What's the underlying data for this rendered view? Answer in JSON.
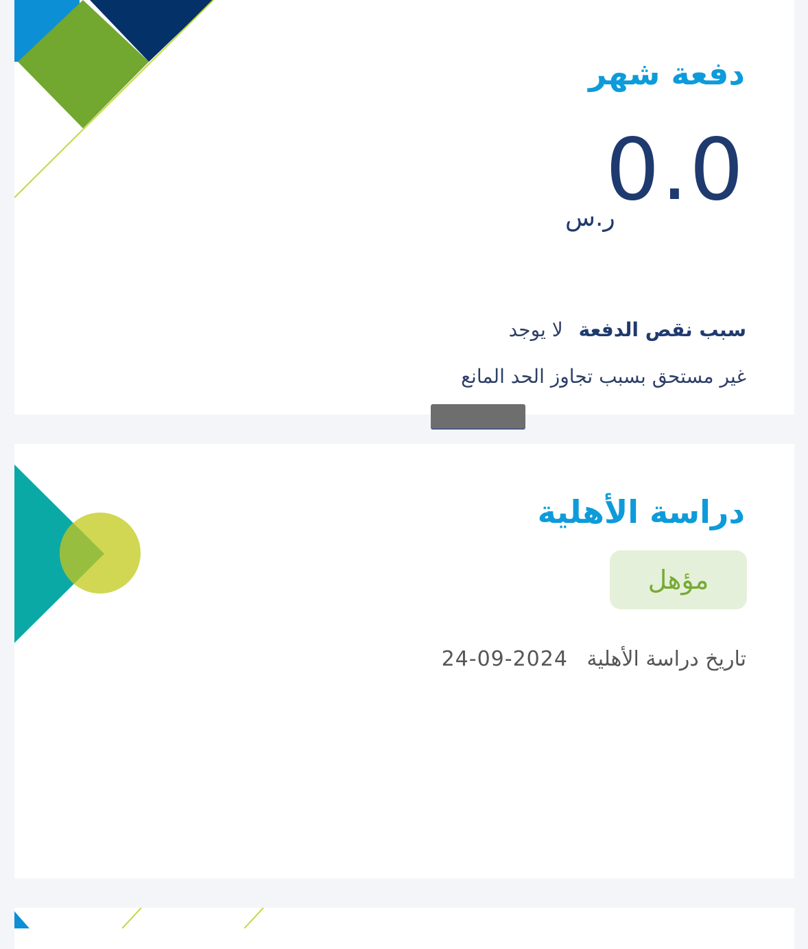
{
  "payment_card": {
    "title": "دفعة شهر",
    "amount": "0.0",
    "currency": "ر.س",
    "shortage_reason_label": "سبب نقص الدفعة",
    "shortage_reason_value": "لا يوجد",
    "eligibility_note": "غير مستحق بسبب تجاوز الحد المانع"
  },
  "eligibility_card": {
    "title": "دراسة الأهلية",
    "status": "مؤهل",
    "date_label": "تاريخ دراسة الأهلية",
    "date_value": "24-09-2024"
  },
  "colors": {
    "title_blue": "#0d9bd9",
    "navy": "#1f3a6e",
    "green": "#72a730",
    "teal": "#0aa9a6",
    "lime": "#cfd54a",
    "badge_bg": "#e5f0da",
    "badge_text": "#76aa34"
  }
}
